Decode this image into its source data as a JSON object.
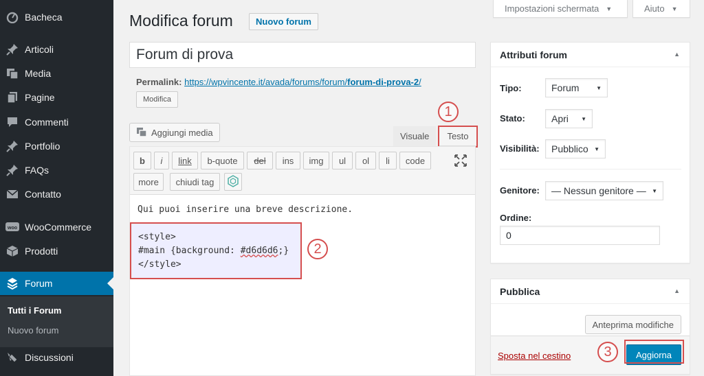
{
  "sidebar": {
    "items": [
      {
        "label": "Bacheca",
        "icon": "dashboard-icon"
      },
      {
        "label": "Articoli",
        "icon": "pin-icon"
      },
      {
        "label": "Media",
        "icon": "media-icon"
      },
      {
        "label": "Pagine",
        "icon": "pages-icon"
      },
      {
        "label": "Commenti",
        "icon": "comment-icon"
      },
      {
        "label": "Portfolio",
        "icon": "pin-icon"
      },
      {
        "label": "FAQs",
        "icon": "pin-icon"
      },
      {
        "label": "Contatto",
        "icon": "envelope-icon"
      },
      {
        "label": "WooCommerce",
        "icon": "woocommerce-icon"
      },
      {
        "label": "Prodotti",
        "icon": "box-icon"
      },
      {
        "label": "Forum",
        "icon": "forum-icon"
      },
      {
        "label": "Discussioni",
        "icon": "discussion-icon"
      }
    ],
    "submenu": [
      "Tutti i Forum",
      "Nuovo forum"
    ]
  },
  "header": {
    "title": "Modifica forum",
    "add_new": "Nuovo forum",
    "screen_options": "Impostazioni schermata",
    "help": "Aiuto"
  },
  "post": {
    "title": "Forum di prova",
    "permalink_label": "Permalink:",
    "permalink_base": "https://wpvincente.it/avada/forums/forum/",
    "permalink_slug": "forum-di-prova-2",
    "permalink_tail": "/",
    "permalink_edit": "Modifica"
  },
  "editor": {
    "add_media": "Aggiungi media",
    "tab_visual": "Visuale",
    "tab_text": "Testo",
    "quicktags": [
      "b",
      "i",
      "link",
      "b-quote",
      "del",
      "ins",
      "img",
      "ul",
      "ol",
      "li",
      "code",
      "more",
      "chiudi tag"
    ],
    "content_line": "Qui puoi inserire una breve descrizione.",
    "style_open": "<style>",
    "style_rule_pre": "#main {background: ",
    "style_rule_hex": "#d6d6d6",
    "style_rule_post": ";}",
    "style_close": "</style>"
  },
  "callouts": [
    "1",
    "2",
    "3"
  ],
  "attributes": {
    "title": "Attributi forum",
    "type_label": "Tipo:",
    "type_value": "Forum",
    "status_label": "Stato:",
    "status_value": "Apri",
    "visibility_label": "Visibilità:",
    "visibility_value": "Pubblico",
    "parent_label": "Genitore:",
    "parent_value": "— Nessun genitore —",
    "order_label": "Ordine:",
    "order_value": "0"
  },
  "publish": {
    "title": "Pubblica",
    "preview": "Anteprima modifiche",
    "trash": "Sposta nel cestino",
    "update": "Aggiorna"
  },
  "colors": {
    "sidebar_bg": "#23282d",
    "accent": "#0073aa",
    "primary_button": "#0085ba",
    "highlight": "#d54e4e"
  }
}
